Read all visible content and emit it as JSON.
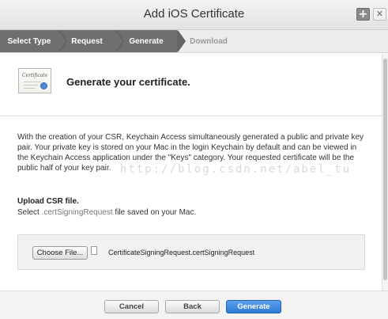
{
  "window": {
    "title": "Add iOS Certificate",
    "add_symbol": "+",
    "close_symbol": "✕"
  },
  "steps": [
    {
      "label": "Select Type",
      "state": "done"
    },
    {
      "label": "Request",
      "state": "done"
    },
    {
      "label": "Generate",
      "state": "current"
    },
    {
      "label": "Download",
      "state": "todo"
    }
  ],
  "header": {
    "icon": "certificate-icon",
    "icon_caption": "Certificate",
    "title": "Generate your certificate."
  },
  "description": "With the creation of your CSR, Keychain Access simultaneously generated a public and private key pair. Your private key is stored on your Mac in the login Keychain by default and can be viewed in the Keychain Access application under the \"Keys\" category. Your requested certificate will be the public half of your key pair.",
  "watermark": "http://blog.csdn.net/abel_tu",
  "upload": {
    "title": "Upload CSR file.",
    "desc_prefix": "Select ",
    "desc_ext": ".certSigningRequest",
    "desc_suffix": " file saved on your Mac.",
    "choose_label": "Choose File...",
    "file_name": "CertificateSigningRequest.certSigningRequest"
  },
  "footer": {
    "cancel_label": "Cancel",
    "back_label": "Back",
    "generate_label": "Generate"
  },
  "colors": {
    "primary_button": "#2f78d6",
    "step_done": "#6f6f6f",
    "step_todo_text": "#9a9a9a"
  }
}
